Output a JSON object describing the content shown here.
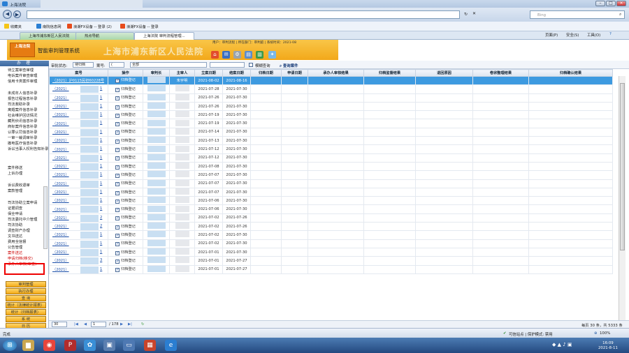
{
  "browser": {
    "window_title": "上海法院",
    "search_placeholder": "Bing",
    "favorites_label": "收藏夹",
    "favorites": [
      "南院信息网",
      "浪潮FX设备 -- 登录 (2)",
      "浪潮FX设备 -- 登录"
    ],
    "tabs": [
      "上海市浦东新区人民法院",
      "热点导航",
      "上海法院 审判流程管理..."
    ],
    "menu_right": [
      "页面(P)",
      "安全(S)",
      "工具(O)"
    ]
  },
  "app": {
    "logo_text": "上海法院",
    "system_name": "智能审判管理系统",
    "court_name": "上海市浦东新区人民法院",
    "user_info": "用户：审判流程 | 所在部门：审判庭 | 系统时间：2021-08"
  },
  "toolbar": {
    "status_label": "审批状态:",
    "status_value": "待归档",
    "case_label": "案号:",
    "case_value": "(",
    "court_value": "全部",
    "fuzzy_label": "模糊查询",
    "query_button": "查询案件"
  },
  "sidebar": {
    "header": "办  理",
    "group1": [
      "待立案审查审理",
      "电诉案件审查审理",
      "信用卡类案件审理"
    ],
    "group2": [
      "未成年人信息补录",
      "报告过程信息补录",
      "司法救助补录",
      "离婚案件信息补录",
      "社会维护回访情况",
      "藏刑侦讯信息补录",
      "商标案件信息补录",
      "认罪认罚信息补录",
      "一审一裁调审补录",
      "撤电医疗信息补录",
      "诉讼当事人权利告知补录"
    ],
    "group3": [
      "案件移送",
      "上诉办理"
    ],
    "group4": [
      "诉讼费收退审",
      "案款管理"
    ],
    "group5": [
      "司法协助立案申请",
      "证据调查",
      "保全申请",
      "司法委托中介管理",
      "司法协助",
      "调查财产办理",
      "文书送达",
      "费用全信督",
      "公告管理",
      "案件送达",
      "申请归档(移交)",
      "承办人审核(审查)"
    ],
    "buttons": [
      "审判管理",
      "执行办理",
      "查  询",
      "统计（法律统计报表）",
      "统计（归档报表）",
      "系  统",
      "日  历"
    ]
  },
  "grid": {
    "headers": [
      "案号",
      "操作",
      "审判长",
      "主审人",
      "立案日期",
      "结案日期",
      "归档日期",
      "申请日期",
      "承办人审核结果",
      "归档监督结果",
      "退回原因",
      "卷宗整理结果",
      "归档确认结果"
    ],
    "action_label": "归档登记",
    "rows": [
      {
        "case": "（2021）沪0115民初60228号",
        "sub": "",
        "filed": "2021-08-02",
        "closed": "2021-08-16",
        "judge": "朱宇明",
        "selected": true
      },
      {
        "case": "（2021）",
        "sub": "1",
        "filed": "2021-07-28",
        "closed": "2021-07-30"
      },
      {
        "case": "（2021）",
        "sub": "1",
        "filed": "2021-07-26",
        "closed": "2021-07-30"
      },
      {
        "case": "（2021）",
        "sub": "1",
        "filed": "2021-07-26",
        "closed": "2021-07-30"
      },
      {
        "case": "（2021）",
        "sub": "1",
        "filed": "2021-07-19",
        "closed": "2021-07-30"
      },
      {
        "case": "（2021）",
        "sub": "1",
        "filed": "2021-07-19",
        "closed": "2021-07-30"
      },
      {
        "case": "（2021）",
        "sub": "1",
        "filed": "2021-07-14",
        "closed": "2021-07-30"
      },
      {
        "case": "（2021）",
        "sub": "1",
        "filed": "2021-07-13",
        "closed": "2021-07-30"
      },
      {
        "case": "（2021）",
        "sub": "1",
        "filed": "2021-07-12",
        "closed": "2021-07-30"
      },
      {
        "case": "（2021）",
        "sub": "1",
        "filed": "2021-07-12",
        "closed": "2021-07-30"
      },
      {
        "case": "（2021）",
        "sub": "1",
        "filed": "2021-07-08",
        "closed": "2021-07-30"
      },
      {
        "case": "（2021）",
        "sub": "1",
        "filed": "2021-07-07",
        "closed": "2021-07-30"
      },
      {
        "case": "（2021）",
        "sub": "1",
        "filed": "2021-07-07",
        "closed": "2021-07-30"
      },
      {
        "case": "（2021）",
        "sub": "1",
        "filed": "2021-07-07",
        "closed": "2021-07-30"
      },
      {
        "case": "（2021）",
        "sub": "1",
        "filed": "2021-07-06",
        "closed": "2021-07-30"
      },
      {
        "case": "（2021）",
        "sub": "1",
        "filed": "2021-07-06",
        "closed": "2021-07-30"
      },
      {
        "case": "（2021）",
        "sub": "2",
        "filed": "2021-07-02",
        "closed": "2021-07-26"
      },
      {
        "case": "（2021）",
        "sub": "2",
        "filed": "2021-07-02",
        "closed": "2021-07-26"
      },
      {
        "case": "（2021）",
        "sub": "1",
        "filed": "2021-07-02",
        "closed": "2021-07-30"
      },
      {
        "case": "（2021）",
        "sub": "1",
        "filed": "2021-07-02",
        "closed": "2021-07-30"
      },
      {
        "case": "（2021）",
        "sub": "1",
        "filed": "2021-07-01",
        "closed": "2021-07-30"
      },
      {
        "case": "（2021）",
        "sub": "3",
        "filed": "2021-07-01",
        "closed": "2021-07-27"
      },
      {
        "case": "（2021）",
        "sub": "1",
        "filed": "2021-07-01",
        "closed": "2021-07-27"
      }
    ]
  },
  "pager": {
    "page_size": "30",
    "current_page": "1",
    "total_pages": "/ 178",
    "summary": "每页 30 条，共 5333 条"
  },
  "statusbar": {
    "left": "完成",
    "zone": "可信站点 | 保护模式: 禁用",
    "zoom": "100%"
  },
  "taskbar": {
    "time": "16:09",
    "date": "2021-8-11"
  }
}
